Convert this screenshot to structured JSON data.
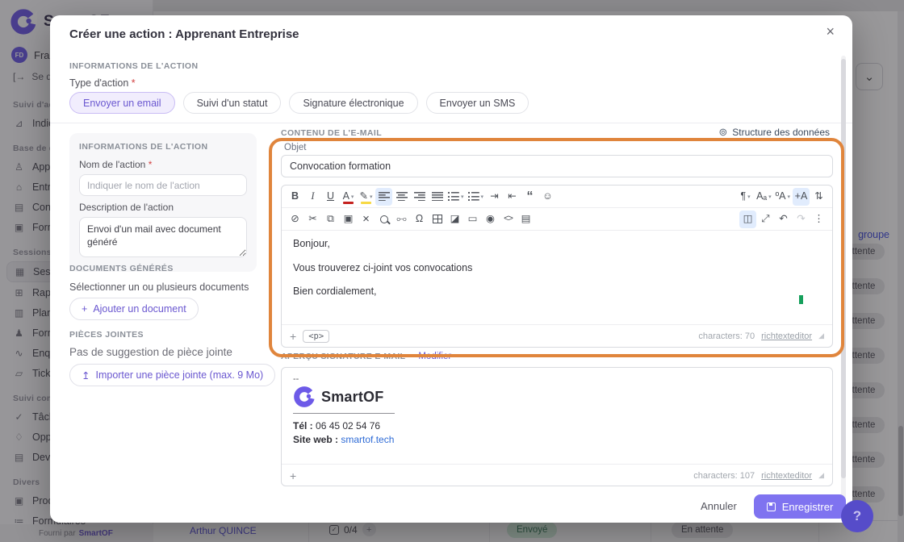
{
  "app": {
    "brand": "SmartOF",
    "footer_provided": "Fourni par",
    "footer_brand": "SmartOF",
    "help_label": "?"
  },
  "sidebar": {
    "user_initials": "FD",
    "user_name": "François",
    "logout_icon": "[→",
    "logout_label": "Se déconnecter",
    "sections": [
      {
        "title": "Suivi d'activité",
        "items": [
          {
            "label": "Indicateurs",
            "glyph": "⊿"
          }
        ]
      },
      {
        "title": "Base de données",
        "items": [
          {
            "label": "Apprenants",
            "glyph": "♙"
          },
          {
            "label": "Entreprises",
            "glyph": "⌂"
          },
          {
            "label": "Contacts",
            "glyph": "▤"
          },
          {
            "label": "Formations",
            "glyph": "▣"
          }
        ]
      },
      {
        "title": "Sessions",
        "items": [
          {
            "label": "Sessions",
            "glyph": "▦"
          },
          {
            "label": "Rapports",
            "glyph": "⊞"
          },
          {
            "label": "Plannings",
            "glyph": "▥"
          },
          {
            "label": "Formateurs",
            "glyph": "♟"
          },
          {
            "label": "Enquêtes",
            "glyph": "∿"
          },
          {
            "label": "Tickets",
            "glyph": "▱"
          }
        ]
      },
      {
        "title": "Suivi commercial",
        "items": [
          {
            "label": "Tâches",
            "glyph": "✓"
          },
          {
            "label": "Opportunités",
            "glyph": "♢"
          },
          {
            "label": "Devis",
            "glyph": "▤"
          }
        ]
      },
      {
        "title": "Divers",
        "items": [
          {
            "label": "Produits",
            "glyph": "▣"
          },
          {
            "label": "Formulaires",
            "glyph": "≔"
          }
        ]
      }
    ]
  },
  "background": {
    "collapse_glyph": "⌄",
    "group_link": "groupe",
    "pending_label": "En attente",
    "pending_short": "En atten",
    "table_row": {
      "name": "Arthur QUINCE",
      "check_glyph": "✓",
      "checklist": "0/4",
      "add_label": "+",
      "status_sent": "Envoyé",
      "status_pending": "En attente"
    }
  },
  "dialog": {
    "title": "Créer une action : Apprenant Entreprise",
    "close_glyph": "×",
    "info_section": "INFORMATIONS DE L'ACTION",
    "type_label": "Type d'action",
    "required_mark": "*",
    "type_options": [
      {
        "label": "Envoyer un email"
      },
      {
        "label": "Suivi d'un statut"
      },
      {
        "label": "Signature électronique"
      },
      {
        "label": "Envoyer un SMS"
      }
    ],
    "form": {
      "section": "INFORMATIONS DE L'ACTION",
      "name_label": "Nom de l'action",
      "name_placeholder": "Indiquer le nom de l'action",
      "desc_label": "Description de l'action",
      "desc_value": "Envoi d'un mail avec document généré"
    },
    "documents": {
      "section": "DOCUMENTS GÉNÉRÉS",
      "hint": "Sélectionner un ou plusieurs documents",
      "add_icon": "+",
      "add_button": "Ajouter un document"
    },
    "attachments": {
      "section": "PIÈCES JOINTES",
      "empty": "Pas de suggestion de pièce jointe",
      "import_icon": "↥",
      "import_button": "Importer une pièce jointe (max. 9 Mo)"
    },
    "email": {
      "section": "CONTENU DE L'E-MAIL",
      "structure_icon": "⊚",
      "structure_link": "Structure des données",
      "subject_label": "Objet",
      "subject_value": "Convocation formation",
      "toolbar1": [
        {
          "name": "bold",
          "glyph": "B"
        },
        {
          "name": "italic",
          "glyph": "I"
        },
        {
          "name": "underline",
          "glyph": "U"
        },
        {
          "name": "font-color",
          "glyph": "A"
        },
        {
          "name": "highlight",
          "glyph": "✎"
        },
        {
          "name": "indent",
          "glyph": "⇥"
        },
        {
          "name": "outdent",
          "glyph": "⇤"
        },
        {
          "name": "blockquote",
          "glyph": "“"
        },
        {
          "name": "emoji",
          "glyph": "☺"
        },
        {
          "name": "paragraph-format",
          "glyph": "¶"
        },
        {
          "name": "font-size",
          "glyph": "Aₐ"
        },
        {
          "name": "text-case",
          "glyph": "ºA"
        },
        {
          "name": "autocomplete",
          "glyph": "+A"
        },
        {
          "name": "line-height",
          "glyph": "⇅"
        }
      ],
      "toolbar2": [
        {
          "name": "remove-format",
          "glyph": "⊘"
        },
        {
          "name": "cut",
          "glyph": "✂"
        },
        {
          "name": "copy",
          "glyph": "⧉"
        },
        {
          "name": "paste",
          "glyph": "▣"
        },
        {
          "name": "delete",
          "glyph": "×"
        },
        {
          "name": "link",
          "glyph": "⧟"
        },
        {
          "name": "special-character",
          "glyph": "Ω"
        },
        {
          "name": "image",
          "glyph": "◪"
        },
        {
          "name": "media",
          "glyph": "▭"
        },
        {
          "name": "preview",
          "glyph": "◉"
        },
        {
          "name": "source-code",
          "glyph": "<>"
        },
        {
          "name": "show-blocks",
          "glyph": "▤"
        },
        {
          "name": "display-block",
          "glyph": "◫"
        },
        {
          "name": "fullscreen",
          "glyph": "⤢"
        },
        {
          "name": "undo",
          "glyph": "↶"
        },
        {
          "name": "redo",
          "glyph": "↷"
        },
        {
          "name": "more",
          "glyph": "⋮"
        }
      ],
      "body_lines": [
        "Bonjour,",
        "Vous trouverez ci-joint vos convocations",
        "Bien cordialement,"
      ],
      "status_plus": "+",
      "tag": "<p>",
      "characters": "characters: 70",
      "editor_link": "richtexteditor",
      "signature_preview_label": "APERÇU SIGNATURE E-MAIL ·",
      "signature_edit": "Modifier",
      "signature": {
        "dashes": "--",
        "brand": "SmartOF",
        "tel_label": "Tél :",
        "tel_value": "06 45 02 54 76",
        "web_label": "Site web :",
        "web_value": "smartof.tech",
        "status_plus": "+",
        "characters": "characters: 107",
        "editor_link": "richtexteditor"
      }
    },
    "footer": {
      "cancel": "Annuler",
      "save": "Enregistrer"
    }
  }
}
